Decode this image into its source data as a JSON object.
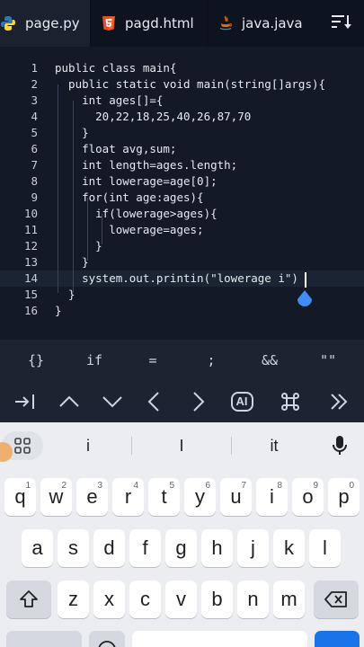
{
  "tabs": [
    {
      "label": "page.py",
      "icon": "python-icon"
    },
    {
      "label": "pagd.html",
      "icon": "html5-icon"
    },
    {
      "label": "java.java",
      "icon": "java-icon"
    }
  ],
  "tab_menu_icon": "sort-menu-icon",
  "editor": {
    "lines": [
      {
        "n": "1",
        "code": "public class main{"
      },
      {
        "n": "2",
        "code": "  public static void main(string[]args){"
      },
      {
        "n": "3",
        "code": "    int ages[]={"
      },
      {
        "n": "4",
        "code": "      20,22,18,25,40,26,87,70"
      },
      {
        "n": "5",
        "code": "    }"
      },
      {
        "n": "6",
        "code": "    float avg,sum;"
      },
      {
        "n": "7",
        "code": "    int length=ages.length;"
      },
      {
        "n": "8",
        "code": "    int lowerage=age[0];"
      },
      {
        "n": "9",
        "code": "    for(int age:ages){"
      },
      {
        "n": "10",
        "code": "      if(lowerage>ages){"
      },
      {
        "n": "11",
        "code": "        lowerage=ages;"
      },
      {
        "n": "12",
        "code": "      }"
      },
      {
        "n": "13",
        "code": "    }"
      },
      {
        "n": "14",
        "code": "    system.out.printin(\"lowerage i\")"
      },
      {
        "n": "15",
        "code": "  }"
      },
      {
        "n": "16",
        "code": "}"
      }
    ],
    "active_line": 14
  },
  "symbols": [
    "{}",
    "if",
    "=",
    ";",
    "&&",
    "\"\""
  ],
  "nav_icons": [
    "tab-indent-icon",
    "chevron-up-icon",
    "chevron-down-icon",
    "chevron-left-icon",
    "chevron-right-icon",
    "ai-icon",
    "command-icon",
    "double-chevron-right-icon"
  ],
  "nav_ai_label": "AI",
  "keyboard": {
    "suggestions": [
      "i",
      "I",
      "it"
    ],
    "row1": [
      {
        "k": "q",
        "s": "1"
      },
      {
        "k": "w",
        "s": "2"
      },
      {
        "k": "e",
        "s": "3"
      },
      {
        "k": "r",
        "s": "4"
      },
      {
        "k": "t",
        "s": "5"
      },
      {
        "k": "y",
        "s": "6"
      },
      {
        "k": "u",
        "s": "7"
      },
      {
        "k": "i",
        "s": "8"
      },
      {
        "k": "o",
        "s": "9"
      },
      {
        "k": "p",
        "s": "0"
      }
    ],
    "row2": [
      "a",
      "s",
      "d",
      "f",
      "g",
      "h",
      "j",
      "k",
      "l"
    ],
    "row3": [
      "z",
      "x",
      "c",
      "v",
      "b",
      "n",
      "m"
    ]
  },
  "colors": {
    "keyword": "#e6e9ef",
    "line_number": "#c9ced8",
    "editor_bg": "#131a26",
    "toolbar_bg": "#1c2432",
    "keyboard_bg": "#ebedf1",
    "python_blue": "#3776ab",
    "python_yellow": "#ffd43b",
    "html_orange": "#e44d26",
    "java_red": "#e76f00",
    "cursor_drop": "#3f8ef5"
  }
}
